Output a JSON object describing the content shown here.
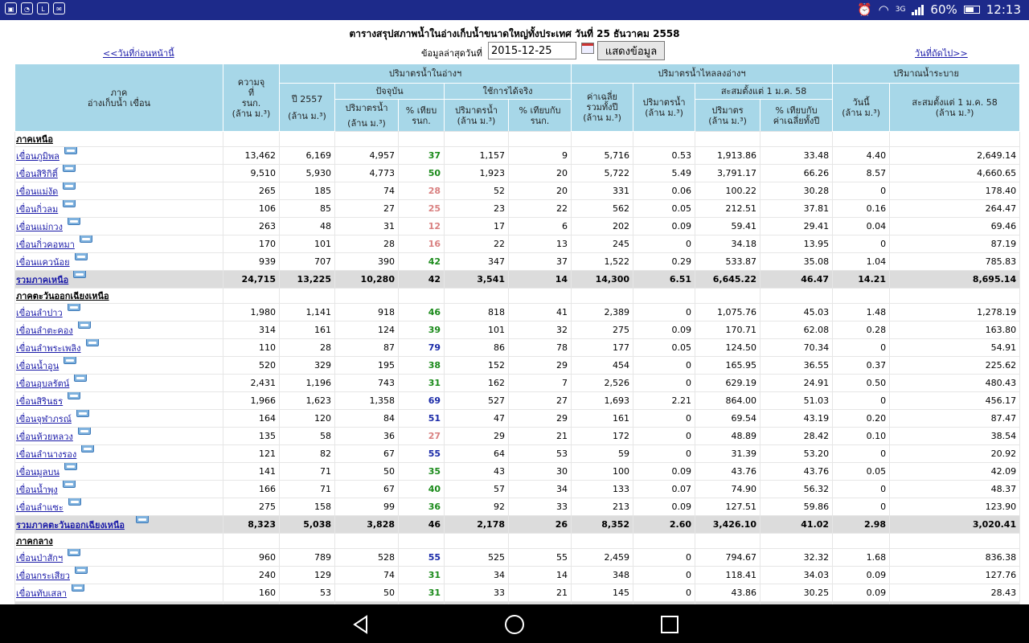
{
  "status": {
    "network": "3G",
    "battery": "60%",
    "time": "12:13",
    "notif_icons": [
      "image-icon",
      "chat-icon",
      "line-icon",
      "mail-icon"
    ]
  },
  "page": {
    "title": "ตารางสรุปสภาพน้ำในอ่างเก็บน้ำขนาดใหญ่ทั้งประเทศ วันที่ 25 ธันวาคม 2558",
    "prev_link": "<<วันที่ก่อนหน้านี้",
    "next_link": "วันที่ถัดไป>>",
    "date_label": "ข้อมูลล่าสุดวันที่",
    "date_value": "2015-12-25",
    "show_button": "แสดงข้อมูล"
  },
  "headers": {
    "name": [
      "ภาค",
      "อ่างเก็บน้ำ เขื่อน"
    ],
    "capacity": [
      "ความจุ",
      "ที่",
      "รนก.",
      "(ล้าน ม.³)"
    ],
    "group_storage": "ปริมาตรน้ำในอ่างฯ",
    "group_inflow": "ปริมาตรน้ำไหลลงอ่างฯ",
    "group_release": "ปริมาณน้ำระบาย",
    "y2557": [
      "ปี 2557",
      "(ล้าน ม.³)"
    ],
    "current": "ปัจจุบัน",
    "usable": "ใช้การได้จริง",
    "cur_vol": [
      "ปริมาตรน้ำ",
      "(ล้าน ม.³)"
    ],
    "cur_pct": [
      "% เทียบ",
      "รนก."
    ],
    "use_vol": [
      "ปริมาตรน้ำ",
      "(ล้าน ม.³)"
    ],
    "use_pct": [
      "% เทียบกับ",
      "รนก."
    ],
    "avg": [
      "ค่าเฉลี่ย",
      "รวมทั้งปี",
      "(ล้าน ม.³)"
    ],
    "inflow_today": [
      "ปริมาตรน้ำ",
      "(ล้าน ม.³)"
    ],
    "accum": "สะสมตั้งแต่ 1 ม.ค. 58",
    "acc_vol": [
      "ปริมาตร",
      "(ล้าน ม.³)"
    ],
    "acc_pct": [
      "% เทียบกับ",
      "ค่าเฉลี่ยทั้งปี"
    ],
    "rel_today": [
      "วันนี้",
      "(ล้าน ม.³)"
    ],
    "rel_accum": [
      "สะสมตั้งแต่ 1 ม.ค. 58",
      "(ล้าน ม.³)"
    ]
  },
  "rows": [
    {
      "type": "region",
      "name": "ภาคเหนือ"
    },
    {
      "type": "dam",
      "name": "เขื่อนภูมิพล",
      "v": [
        "13,462",
        "6,169",
        "4,957",
        "37",
        "1,157",
        "9",
        "5,716",
        "0.53",
        "1,913.86",
        "33.48",
        "4.40",
        "2,649.14"
      ],
      "pc": "green"
    },
    {
      "type": "dam",
      "name": "เขื่อนสิริกิติ์",
      "v": [
        "9,510",
        "5,930",
        "4,773",
        "50",
        "1,923",
        "20",
        "5,722",
        "5.49",
        "3,791.17",
        "66.26",
        "8.57",
        "4,660.65"
      ],
      "pc": "green"
    },
    {
      "type": "dam",
      "name": "เขื่อนแม่งัด",
      "v": [
        "265",
        "185",
        "74",
        "28",
        "52",
        "20",
        "331",
        "0.06",
        "100.22",
        "30.28",
        "0",
        "178.40"
      ],
      "pc": "red"
    },
    {
      "type": "dam",
      "name": "เขื่อนกิ่วลม",
      "v": [
        "106",
        "85",
        "27",
        "25",
        "23",
        "22",
        "562",
        "0.05",
        "212.51",
        "37.81",
        "0.16",
        "264.47"
      ],
      "pc": "red"
    },
    {
      "type": "dam",
      "name": "เขื่อนแม่กวง",
      "v": [
        "263",
        "48",
        "31",
        "12",
        "17",
        "6",
        "202",
        "0.09",
        "59.41",
        "29.41",
        "0.04",
        "69.46"
      ],
      "pc": "red"
    },
    {
      "type": "dam",
      "name": "เขื่อนกิ่วคอหมา",
      "v": [
        "170",
        "101",
        "28",
        "16",
        "22",
        "13",
        "245",
        "0",
        "34.18",
        "13.95",
        "0",
        "87.19"
      ],
      "pc": "red"
    },
    {
      "type": "dam",
      "name": "เขื่อนแควน้อย",
      "v": [
        "939",
        "707",
        "390",
        "42",
        "347",
        "37",
        "1,522",
        "0.29",
        "533.87",
        "35.08",
        "1.04",
        "785.83"
      ],
      "pc": "green"
    },
    {
      "type": "total",
      "name": "รวมภาคเหนือ",
      "v": [
        "24,715",
        "13,225",
        "10,280",
        "42",
        "3,541",
        "14",
        "14,300",
        "6.51",
        "6,645.22",
        "46.47",
        "14.21",
        "8,695.14"
      ]
    },
    {
      "type": "region",
      "name": "ภาคตะวันออกเฉียงเหนือ"
    },
    {
      "type": "dam",
      "name": "เขื่อนลำปาว",
      "v": [
        "1,980",
        "1,141",
        "918",
        "46",
        "818",
        "41",
        "2,389",
        "0",
        "1,075.76",
        "45.03",
        "1.48",
        "1,278.19"
      ],
      "pc": "green"
    },
    {
      "type": "dam",
      "name": "เขื่อนลำตะคอง",
      "v": [
        "314",
        "161",
        "124",
        "39",
        "101",
        "32",
        "275",
        "0.09",
        "170.71",
        "62.08",
        "0.28",
        "163.80"
      ],
      "pc": "green"
    },
    {
      "type": "dam",
      "name": "เขื่อนลำพระเพลิง",
      "v": [
        "110",
        "28",
        "87",
        "79",
        "86",
        "78",
        "177",
        "0.05",
        "124.50",
        "70.34",
        "0",
        "54.91"
      ],
      "pc": "blue"
    },
    {
      "type": "dam",
      "name": "เขื่อนน้ำอูน",
      "v": [
        "520",
        "329",
        "195",
        "38",
        "152",
        "29",
        "454",
        "0",
        "165.95",
        "36.55",
        "0.37",
        "225.62"
      ],
      "pc": "green"
    },
    {
      "type": "dam",
      "name": "เขื่อนอุบลรัตน์",
      "v": [
        "2,431",
        "1,196",
        "743",
        "31",
        "162",
        "7",
        "2,526",
        "0",
        "629.19",
        "24.91",
        "0.50",
        "480.43"
      ],
      "pc": "green"
    },
    {
      "type": "dam",
      "name": "เขื่อนสิรินธร",
      "v": [
        "1,966",
        "1,623",
        "1,358",
        "69",
        "527",
        "27",
        "1,693",
        "2.21",
        "864.00",
        "51.03",
        "0",
        "456.17"
      ],
      "pc": "blue"
    },
    {
      "type": "dam",
      "name": "เขื่อนจุฬาภรณ์",
      "v": [
        "164",
        "120",
        "84",
        "51",
        "47",
        "29",
        "161",
        "0",
        "69.54",
        "43.19",
        "0.20",
        "87.47"
      ],
      "pc": "blue"
    },
    {
      "type": "dam",
      "name": "เขื่อนห้วยหลวง",
      "v": [
        "135",
        "58",
        "36",
        "27",
        "29",
        "21",
        "172",
        "0",
        "48.89",
        "28.42",
        "0.10",
        "38.54"
      ],
      "pc": "red"
    },
    {
      "type": "dam",
      "name": "เขื่อนลำนางรอง",
      "v": [
        "121",
        "82",
        "67",
        "55",
        "64",
        "53",
        "59",
        "0",
        "31.39",
        "53.20",
        "0",
        "20.92"
      ],
      "pc": "blue"
    },
    {
      "type": "dam",
      "name": "เขื่อนมูลบน",
      "v": [
        "141",
        "71",
        "50",
        "35",
        "43",
        "30",
        "100",
        "0.09",
        "43.76",
        "43.76",
        "0.05",
        "42.09"
      ],
      "pc": "green"
    },
    {
      "type": "dam",
      "name": "เขื่อนน้ำพุง",
      "v": [
        "166",
        "71",
        "67",
        "40",
        "57",
        "34",
        "133",
        "0.07",
        "74.90",
        "56.32",
        "0",
        "48.37"
      ],
      "pc": "green"
    },
    {
      "type": "dam",
      "name": "เขื่อนลำแซะ",
      "v": [
        "275",
        "158",
        "99",
        "36",
        "92",
        "33",
        "213",
        "0.09",
        "127.51",
        "59.86",
        "0",
        "123.90"
      ],
      "pc": "green"
    },
    {
      "type": "total",
      "name": "รวมภาคตะวันออกเฉียงเหนือ",
      "v": [
        "8,323",
        "5,038",
        "3,828",
        "46",
        "2,178",
        "26",
        "8,352",
        "2.60",
        "3,426.10",
        "41.02",
        "2.98",
        "3,020.41"
      ]
    },
    {
      "type": "region",
      "name": "ภาคกลาง"
    },
    {
      "type": "dam",
      "name": "เขื่อนป่าสักฯ",
      "v": [
        "960",
        "789",
        "528",
        "55",
        "525",
        "55",
        "2,459",
        "0",
        "794.67",
        "32.32",
        "1.68",
        "836.38"
      ],
      "pc": "blue"
    },
    {
      "type": "dam",
      "name": "เขื่อนกระเสียว",
      "v": [
        "240",
        "129",
        "74",
        "31",
        "34",
        "14",
        "348",
        "0",
        "118.41",
        "34.03",
        "0.09",
        "127.76"
      ],
      "pc": "green"
    },
    {
      "type": "dam",
      "name": "เขื่อนทับเสลา",
      "v": [
        "160",
        "53",
        "50",
        "31",
        "33",
        "21",
        "145",
        "0",
        "43.86",
        "30.25",
        "0.09",
        "28.43"
      ],
      "pc": "green"
    },
    {
      "type": "total",
      "name": "",
      "v": [
        "",
        "",
        "",
        "",
        "",
        "",
        "",
        "",
        "",
        "",
        "",
        ""
      ]
    }
  ],
  "colors": {
    "header_bg": "#a7d7e8",
    "total_bg": "#dcdcdc",
    "link": "#1a1aa8",
    "pct_green": "#1a8a1a",
    "pct_red": "#d98080",
    "pct_blue": "#1a2aa8",
    "statusbar": "#1d2a8a"
  }
}
